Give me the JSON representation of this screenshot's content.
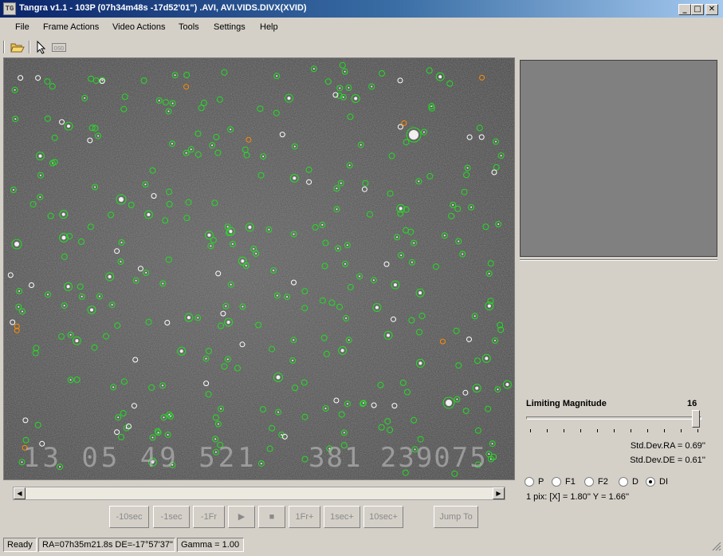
{
  "window": {
    "app_icon_text": "TG",
    "title": "Tangra v1.1  - 103P (07h34m48s -17d52'01\") .AVI, AVI.VIDS.DIVX(XVID)",
    "minimize": "_",
    "maximize": "□",
    "close": "✕"
  },
  "menu": {
    "items": [
      "File",
      "Frame Actions",
      "Video Actions",
      "Tools",
      "Settings",
      "Help"
    ]
  },
  "toolbar": {
    "icons": [
      "open-folder-icon",
      "pointer-icon",
      "osd-icon"
    ],
    "osd_label": "OSD"
  },
  "video": {
    "osd_timestamp": "13 05 49 521",
    "osd_frame": "381 239075"
  },
  "playback": {
    "buttons": [
      "-10sec",
      "-1sec",
      "-1Fr",
      "▶",
      "■",
      "1Fr+",
      "1sec+",
      "10sec+"
    ],
    "jump_label": "Jump To"
  },
  "panel": {
    "limit_label": "Limiting Magnitude",
    "limit_value": "16",
    "std_ra": "Std.Dev.RA = 0.69''",
    "std_de": "Std.Dev.DE = 0.61''",
    "radio_options": [
      "P",
      "F1",
      "F2",
      "D",
      "DI"
    ],
    "radio_selected": "DI",
    "pixel_scale": "1 pix: [X] = 1.80''  Y = 1.66''"
  },
  "status": {
    "state": "Ready",
    "coords": "RA=07h35m21.8s DE=-17°57'37\"",
    "gamma": "Gamma = 1.00"
  },
  "colors": {
    "identified_star": "#22dd22",
    "unidentified_star": "#ffffff",
    "comet_marker": "#ff8c00",
    "titlebar": "#0a246a"
  }
}
